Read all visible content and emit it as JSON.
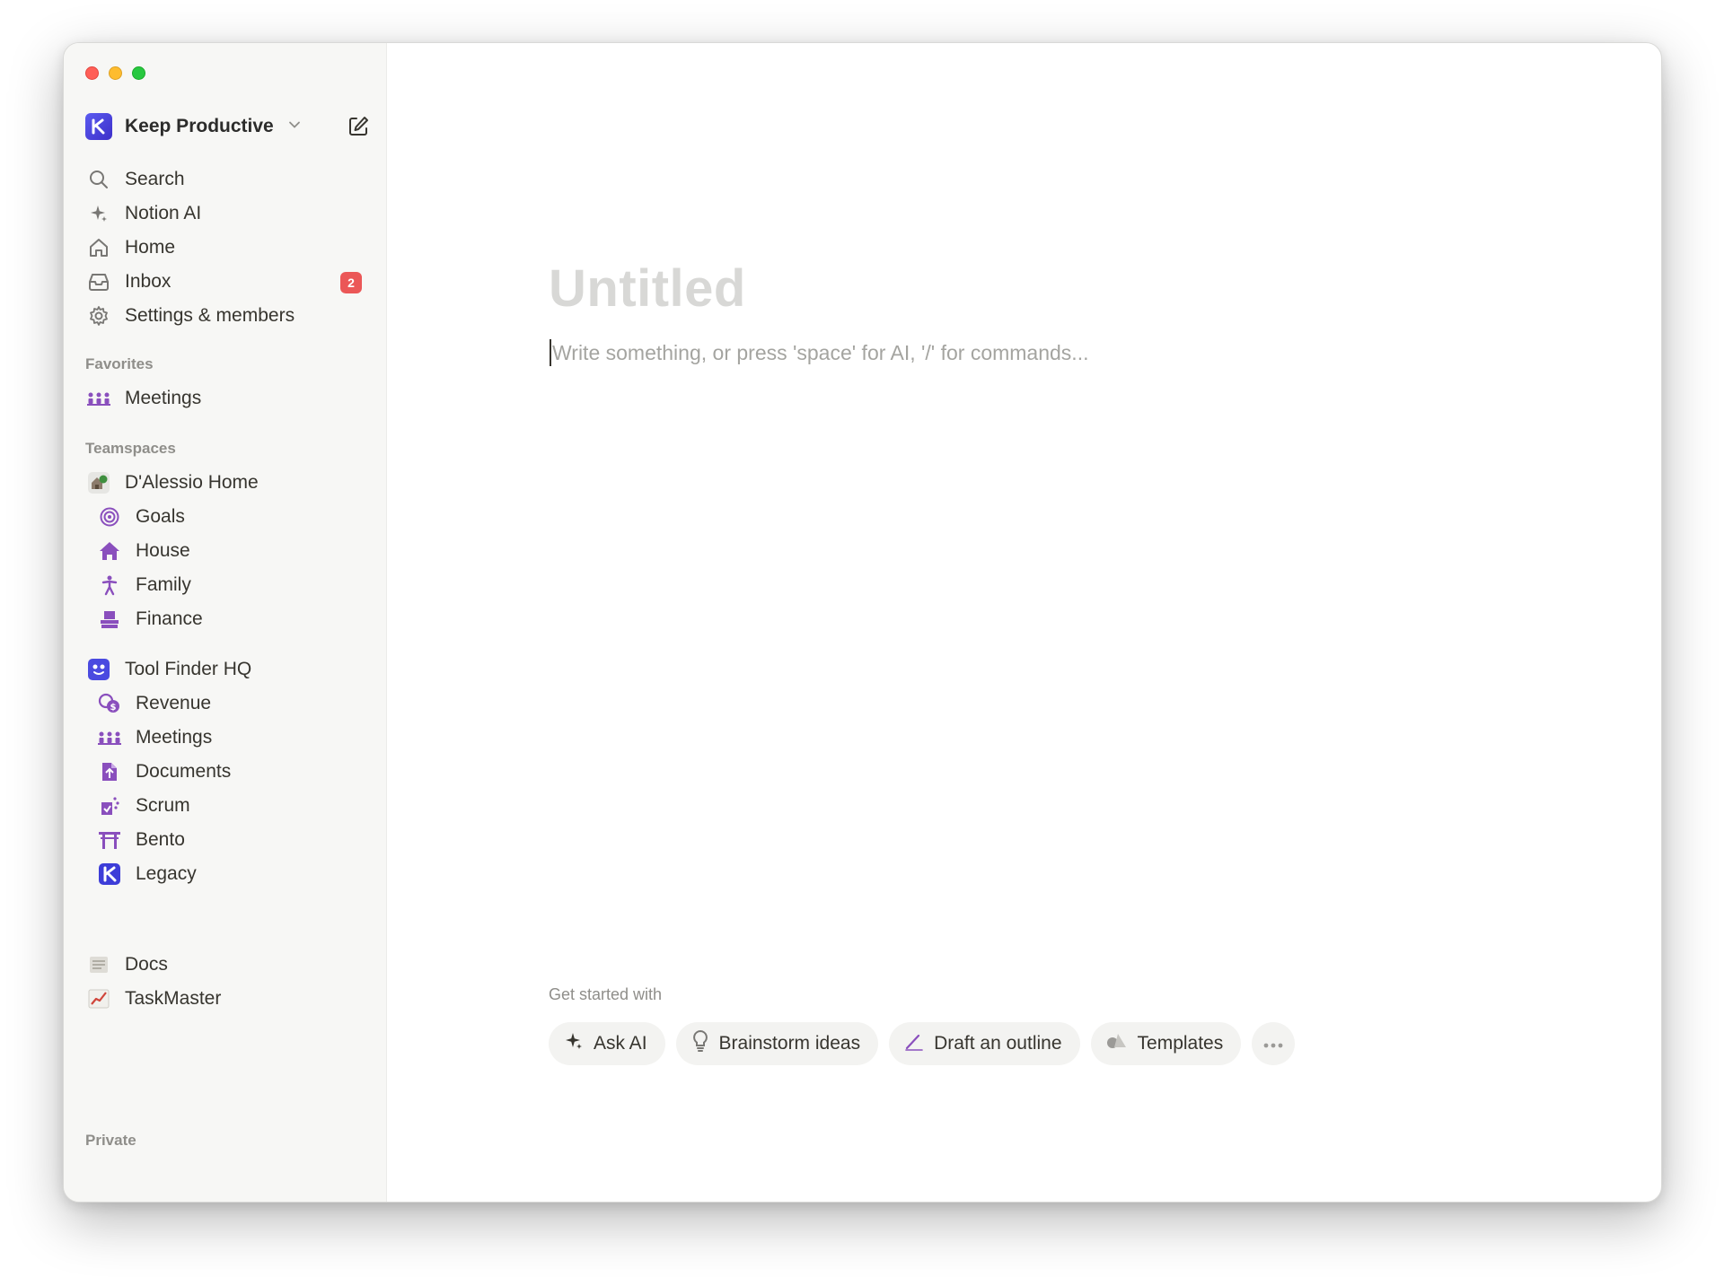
{
  "workspace": {
    "name": "Keep Productive"
  },
  "nav": {
    "search": "Search",
    "notion_ai": "Notion AI",
    "home": "Home",
    "inbox": "Inbox",
    "inbox_badge": "2",
    "settings": "Settings & members"
  },
  "favorites": {
    "label": "Favorites",
    "items": [
      {
        "label": "Meetings",
        "icon": "meetings-icon"
      }
    ]
  },
  "teamspaces": {
    "label": "Teamspaces",
    "groups": [
      {
        "name": "D'Alessio Home",
        "icon": "home-garden-icon",
        "children": [
          {
            "label": "Goals",
            "icon": "target-icon"
          },
          {
            "label": "House",
            "icon": "house-icon"
          },
          {
            "label": "Family",
            "icon": "person-icon"
          },
          {
            "label": "Finance",
            "icon": "bank-icon"
          }
        ]
      },
      {
        "name": "Tool Finder HQ",
        "icon": "toolfinder-logo-icon",
        "children": [
          {
            "label": "Revenue",
            "icon": "coins-icon"
          },
          {
            "label": "Meetings",
            "icon": "meetings-icon"
          },
          {
            "label": "Documents",
            "icon": "document-icon"
          },
          {
            "label": "Scrum",
            "icon": "scrum-icon"
          },
          {
            "label": "Bento",
            "icon": "torii-icon"
          },
          {
            "label": "Legacy",
            "icon": "legacy-logo-icon"
          }
        ]
      }
    ]
  },
  "private": {
    "label": "Private",
    "items": [
      {
        "label": "Docs",
        "icon": "scroll-icon"
      },
      {
        "label": "TaskMaster",
        "icon": "chart-increasing-icon"
      }
    ]
  },
  "page": {
    "title_placeholder": "Untitled",
    "body_placeholder": "Write something, or press 'space' for AI, '/' for commands...",
    "get_started_label": "Get started with",
    "actions": [
      {
        "label": "Ask AI",
        "icon": "sparkle-icon"
      },
      {
        "label": "Brainstorm ideas",
        "icon": "lightbulb-icon"
      },
      {
        "label": "Draft an outline",
        "icon": "pen-icon"
      },
      {
        "label": "Templates",
        "icon": "shapes-icon"
      }
    ]
  },
  "colors": {
    "accent_purple": "#8a4fbd",
    "badge_red": "#eb5757",
    "sidebar_bg": "#f7f7f5"
  }
}
